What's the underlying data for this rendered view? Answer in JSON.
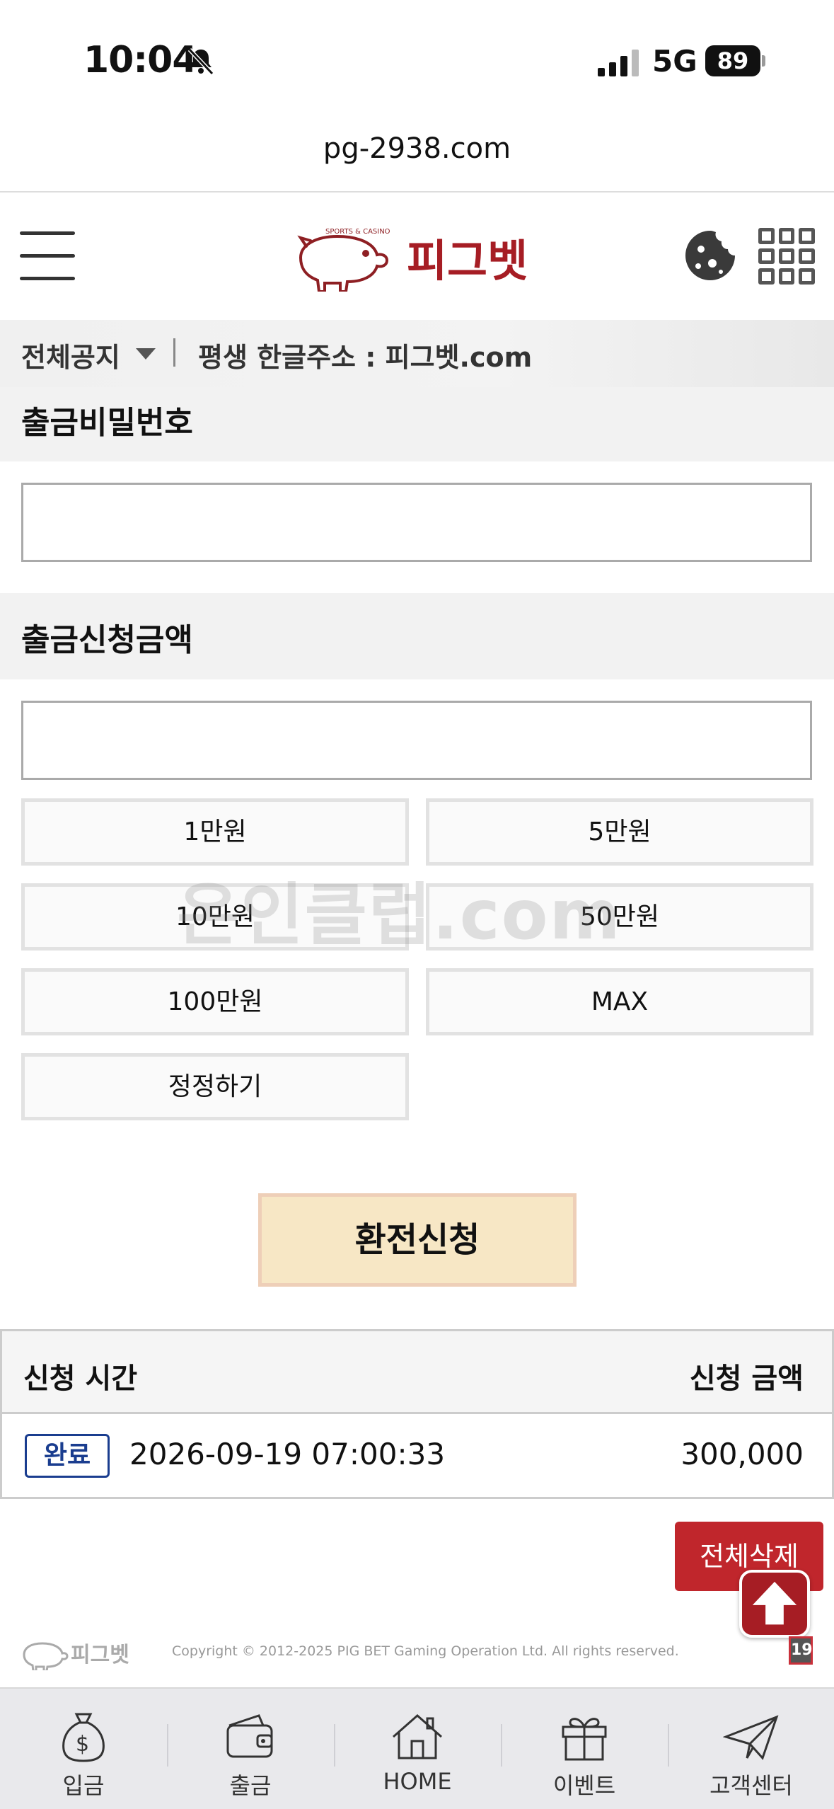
{
  "status_bar": {
    "time": "10:04",
    "network": "5G",
    "battery": "89"
  },
  "url": "pg-2938.com",
  "header": {
    "logo_text": "피그벳",
    "logo_tagline": "SPORTS & CASINO"
  },
  "notice": {
    "label": "전체공지",
    "text": "평생 한글주소 : 피그벳.com"
  },
  "password_section": {
    "title": "출금비밀번호",
    "value": ""
  },
  "amount_section": {
    "title": "출금신청금액",
    "value": ""
  },
  "amount_buttons": [
    {
      "label": "1만원"
    },
    {
      "label": "5만원"
    },
    {
      "label": "10만원"
    },
    {
      "label": "50만원"
    },
    {
      "label": "100만원"
    },
    {
      "label": "MAX"
    },
    {
      "label": "정정하기"
    }
  ],
  "apply_button": "환전신청",
  "table": {
    "col_time": "신청 시간",
    "col_amount": "신청 금액",
    "rows": [
      {
        "status": "완료",
        "time": "2026-09-19 07:00:33",
        "amount": "300,000"
      }
    ]
  },
  "delete_all_button": "전체삭제",
  "watermark": "온인클럽.com",
  "footer": {
    "logo_text": "피그벳",
    "copyright": "Copyright © 2012-2025 PIG BET Gaming Operation Ltd. All rights reserved.",
    "age_badge": "19"
  },
  "bottom_nav": [
    {
      "label": "입금",
      "icon": "money-bag-icon"
    },
    {
      "label": "출금",
      "icon": "wallet-icon"
    },
    {
      "label": "HOME",
      "icon": "home-icon"
    },
    {
      "label": "이벤트",
      "icon": "gift-icon"
    },
    {
      "label": "고객센터",
      "icon": "paper-plane-icon"
    }
  ],
  "colors": {
    "brand_red": "#a61d24",
    "apply_bg": "#f7e7c5",
    "badge_blue": "#1a3d8f"
  }
}
